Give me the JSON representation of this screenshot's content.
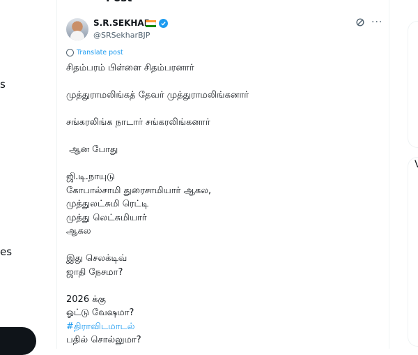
{
  "left_nav": {
    "frag_1": "s",
    "frag_2": "es"
  },
  "post": {
    "author_name": "S.R.SEKHAR",
    "author_handle": "@SRSekharBJP",
    "flag_colors": [
      "#ff9933",
      "#ffffff",
      "#138808"
    ],
    "verified_color": "#1d9bf0",
    "translate_label": "Translate post",
    "lines": [
      "சிதம்பரம் பிள்ளை சிதம்பரனார்",
      "",
      "முத்துராமலிங்கத் தேவர் முத்துராமலிங்கனார்",
      "",
      "சங்கரலிங்க நாடார் சங்கரலிங்கனார்",
      "",
      " ஆன போது",
      "",
      "ஜி.டி.நாயுடு",
      "கோபால்சாமி துரைசாமியார் ஆகல,",
      "முத்துலட்சுமி ரெட்டி",
      "முத்து லெட்சுமியார்",
      "ஆகல",
      "",
      "இது செலக்டிவ்",
      "ஜாதி நேசமா?",
      "",
      "2026 க்கு",
      "ஓட்டு வேஷமா?",
      "#திராவிடமாடல்",
      "பதில் சொல்லுமா?"
    ],
    "hashtag": "#திராவிடமாடல்"
  },
  "icons": {
    "grok": "grok-icon",
    "more": "more-icon",
    "translate": "globe-icon",
    "verified": "verified-badge-icon"
  },
  "right_sidebar": {
    "char_1": "V",
    "char_2": "V"
  }
}
